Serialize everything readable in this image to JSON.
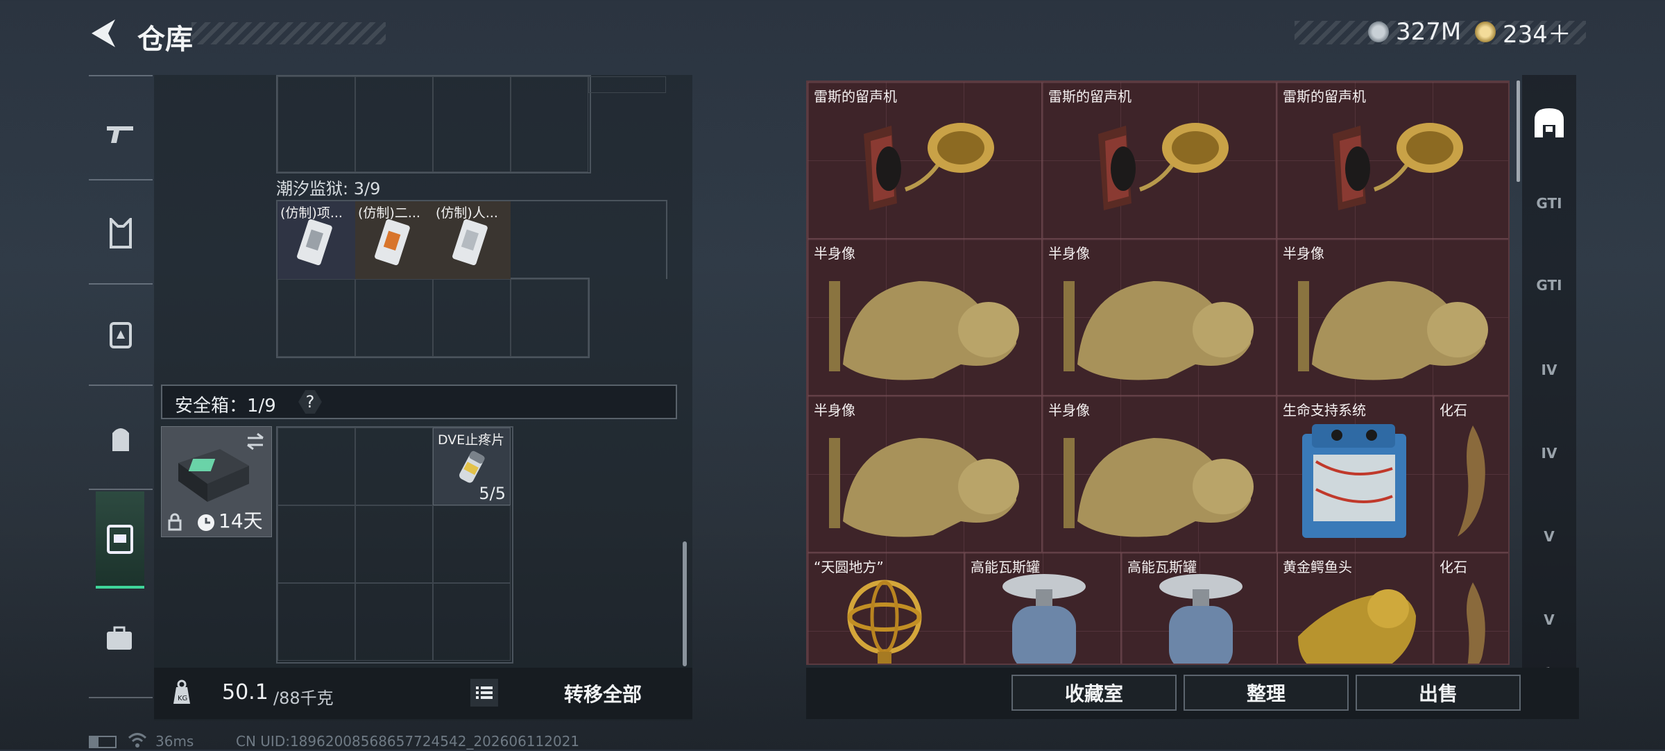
{
  "header": {
    "title": "仓库",
    "currency1": "327M",
    "currency2": "234＋"
  },
  "left_panel": {
    "prison_label": "潮汐监狱: 3/9",
    "prison_items": [
      "(仿制)项...",
      "(仿制)二...",
      "(仿制)人..."
    ],
    "safe_box_label": "安全箱：1/9",
    "safe_help": "?",
    "safe_timer": "14天",
    "dve_name": "DVE止疼片",
    "dve_count": "5/5",
    "weight_value": "50.1",
    "weight_capacity": "/88千克",
    "transfer_all": "转移全部"
  },
  "right_panel": {
    "items": [
      {
        "name": "雷斯的留声机"
      },
      {
        "name": "雷斯的留声机"
      },
      {
        "name": "雷斯的留声机"
      },
      {
        "name": "半身像"
      },
      {
        "name": "半身像"
      },
      {
        "name": "半身像"
      },
      {
        "name": "半身像"
      },
      {
        "name": "半身像"
      },
      {
        "name": "生命支持系统"
      },
      {
        "name": "化石"
      },
      {
        "name": "“天圆地方”"
      },
      {
        "name": "高能瓦斯罐"
      },
      {
        "name": "高能瓦斯罐"
      },
      {
        "name": "黄金鳄鱼头"
      },
      {
        "name": "化石"
      }
    ],
    "side_tabs": [
      "GTI",
      "GTI",
      "IV",
      "IV",
      "V",
      "V"
    ]
  },
  "actions": {
    "collection": "收藏室",
    "sort": "整理",
    "sell": "出售"
  },
  "status_bar": {
    "ping": "36ms",
    "uid": "CN UID:18962008568657724542_202606112021"
  }
}
